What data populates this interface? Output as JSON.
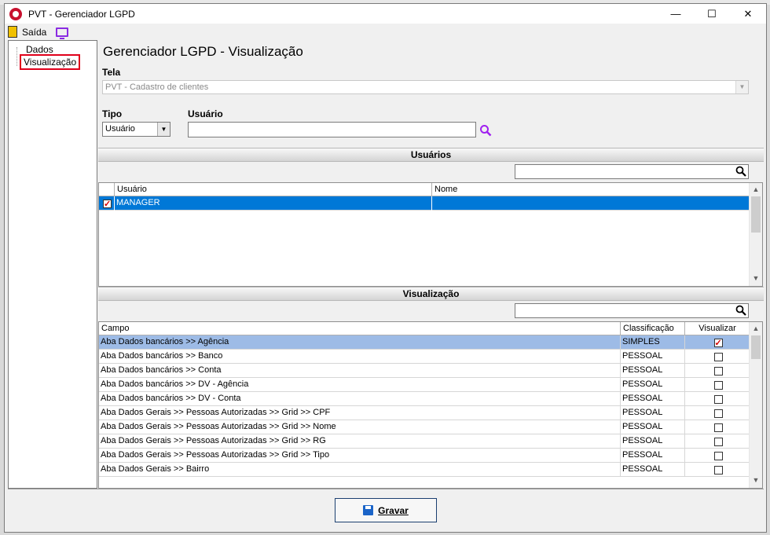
{
  "window": {
    "title": "PVT - Gerenciador LGPD",
    "minimize": "—",
    "maximize": "☐",
    "close": "✕"
  },
  "toolbar": {
    "exit_label": "Saída"
  },
  "tree": {
    "items": [
      "Dados",
      "Visualização"
    ]
  },
  "page": {
    "title": "Gerenciador LGPD - Visualização",
    "tela_label": "Tela",
    "tela_value": "PVT - Cadastro de clientes",
    "tipo_label": "Tipo",
    "tipo_value": "Usuário",
    "usuario_label": "Usuário",
    "usuario_value": ""
  },
  "users_section": {
    "title": "Usuários",
    "columns": [
      "Usuário",
      "Nome"
    ],
    "rows": [
      {
        "checked": true,
        "usuario": "MANAGER",
        "nome": ""
      }
    ]
  },
  "view_section": {
    "title": "Visualização",
    "columns": [
      "Campo",
      "Classificação",
      "Visualizar"
    ],
    "rows": [
      {
        "campo": "Aba Dados bancários >> Agência",
        "classificacao": "SIMPLES",
        "visualizar": true
      },
      {
        "campo": "Aba Dados bancários >> Banco",
        "classificacao": "PESSOAL",
        "visualizar": false
      },
      {
        "campo": "Aba Dados bancários >> Conta",
        "classificacao": "PESSOAL",
        "visualizar": false
      },
      {
        "campo": "Aba Dados bancários >> DV - Agência",
        "classificacao": "PESSOAL",
        "visualizar": false
      },
      {
        "campo": "Aba Dados bancários >> DV - Conta",
        "classificacao": "PESSOAL",
        "visualizar": false
      },
      {
        "campo": "Aba Dados Gerais >>  Pessoas Autorizadas >> Grid >> CPF",
        "classificacao": "PESSOAL",
        "visualizar": false
      },
      {
        "campo": "Aba Dados Gerais >>  Pessoas Autorizadas >> Grid >> Nome",
        "classificacao": "PESSOAL",
        "visualizar": false
      },
      {
        "campo": "Aba Dados Gerais >>  Pessoas Autorizadas >> Grid >> RG",
        "classificacao": "PESSOAL",
        "visualizar": false
      },
      {
        "campo": "Aba Dados Gerais >>  Pessoas Autorizadas >> Grid >> Tipo",
        "classificacao": "PESSOAL",
        "visualizar": false
      },
      {
        "campo": "Aba Dados Gerais >> Bairro",
        "classificacao": "PESSOAL",
        "visualizar": false
      }
    ]
  },
  "footer": {
    "save_label": "Gravar"
  },
  "colors": {
    "selection": "#0078d7",
    "row_highlight": "#9dbbe6",
    "tree_highlight": "#e0001b",
    "search_icon": "#a020f0"
  },
  "icons": [
    "app-logo-icon",
    "exit-door-icon",
    "monitor-icon",
    "magnifier-icon",
    "floppy-disk-icon"
  ]
}
